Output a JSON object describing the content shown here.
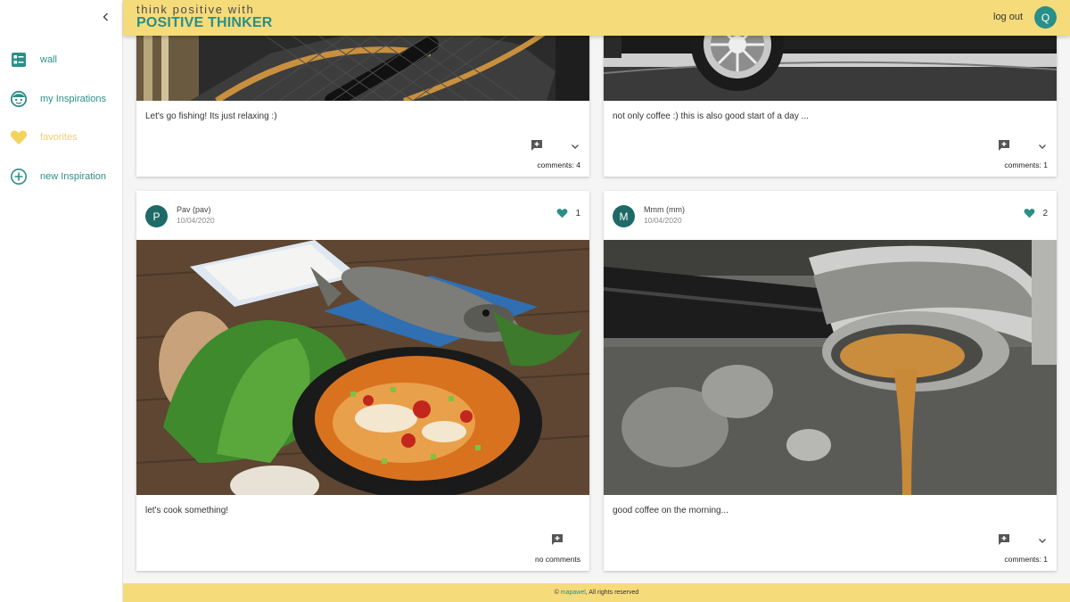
{
  "header": {
    "tagline": "think positive with",
    "brand": "POSITIVE THINKER",
    "logout_label": "log out",
    "user_initial": "Q"
  },
  "sidebar": {
    "items": [
      {
        "label": "wall",
        "icon": "wall-icon"
      },
      {
        "label": "my Inspirations",
        "icon": "face-icon"
      },
      {
        "label": "favorites",
        "icon": "heart-icon"
      },
      {
        "label": "new Inspiration",
        "icon": "add-circle-icon"
      }
    ]
  },
  "posts": [
    {
      "caption": "Let's go fishing! Its just relaxing :)",
      "comments": "comments: 4"
    },
    {
      "caption": "not only coffee :) this is also good start of a day ...",
      "comments": "comments: 1"
    },
    {
      "author_initial": "P",
      "author": "Pav (pav)",
      "date": "10/04/2020",
      "likes": "1",
      "caption": "let's cook something!",
      "comments": "no comments"
    },
    {
      "author_initial": "M",
      "author": "Mmm (mm)",
      "date": "10/04/2020",
      "likes": "2",
      "caption": "good coffee on the morning...",
      "comments": "comments: 1"
    }
  ],
  "footer": {
    "copyright": "©",
    "author": "mapawel",
    "rights": ", All rights reserved"
  },
  "colors": {
    "accent": "#2a8f88",
    "header_bg": "#f6db7b",
    "favorites": "#ecd06a"
  }
}
